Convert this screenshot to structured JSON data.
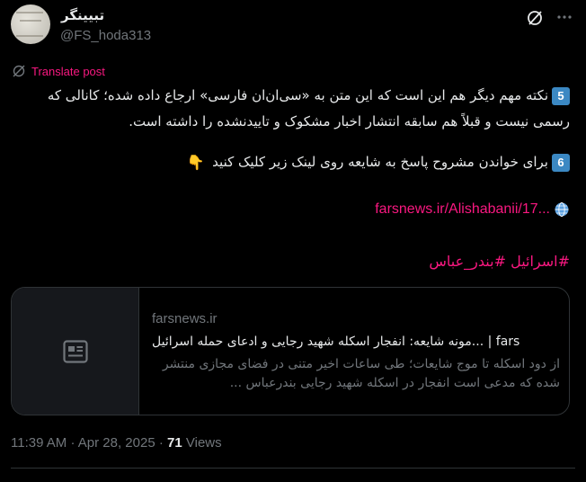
{
  "author": {
    "display_name": "تبیینگر",
    "handle": "@FS_hoda313"
  },
  "icons": {
    "avatar": "avatar-image",
    "grok": "grok-slash-circle-icon",
    "more": "more-dots-icon",
    "translate": "translate-icon",
    "globe": "globe-icon",
    "card_thumb": "article-icon"
  },
  "translate_label": "Translate post",
  "post": {
    "line1_num": "5",
    "line1": "نکته مهم دیگر هم این است که این متن به «سی‌ان‌ان فارسی» ارجاع داده شده؛ کانالی که رسمی نیست و قبلاً هم سابقه انتشار اخبار مشکوک و تاییدنشده را داشته است.",
    "line2_num": "6",
    "line2": "برای خواندن مشروح پاسخ به شایعه روی لینک زیر کلیک کنید",
    "line2_emoji": "👇",
    "link": "farsnews.ir/Alishabanii/17...",
    "hashtags": "#اسرائیل #بندر_عباس"
  },
  "card": {
    "domain": "farsnews.ir",
    "title": "fars | ...مونه شایعه: انفجار اسکله شهید رجایی و ادعای حمله اسرائیل",
    "description": "از دود اسکله تا موج شایعات؛ طی ساعات اخیر متنی در فضای مجازی منتشر شده که مدعی است انفجار در اسکله شهید رجایی بندرعباس ..."
  },
  "meta": {
    "time": "11:39 AM",
    "separator": "·",
    "date": "Apr 28, 2025",
    "views_count": "71",
    "views_label": "Views"
  },
  "colors": {
    "background": "#000000",
    "text": "#e7e9ea",
    "muted": "#71767b",
    "accent": "#f91880",
    "border": "#2f3336",
    "badge": "#3b88c3"
  }
}
